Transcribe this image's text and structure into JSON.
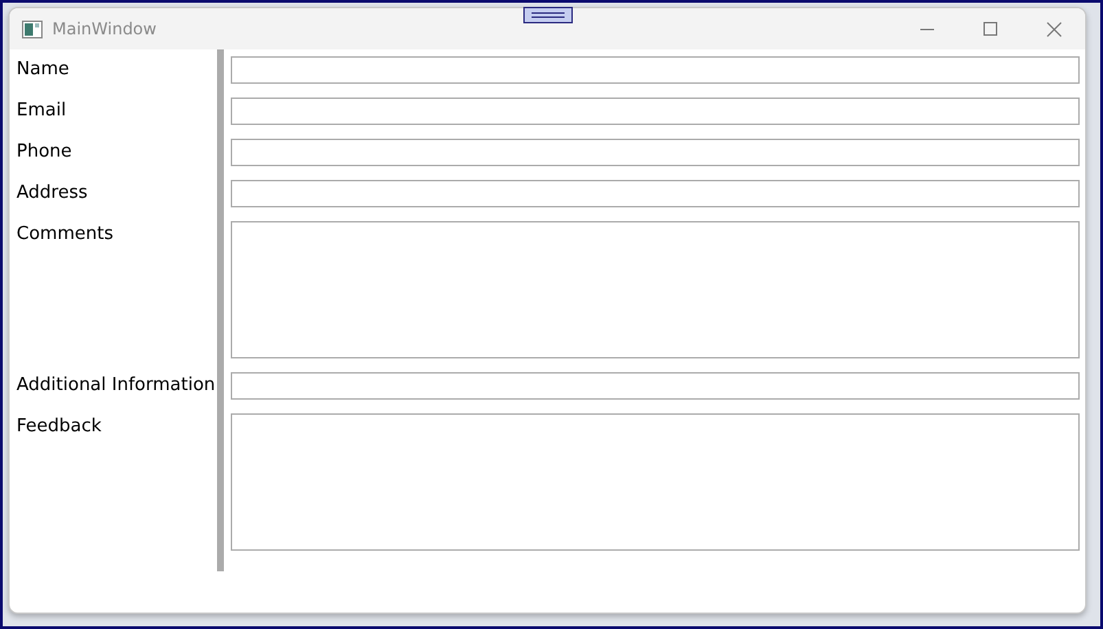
{
  "window": {
    "title": "MainWindow"
  },
  "fields": [
    {
      "label": "Name",
      "kind": "single"
    },
    {
      "label": "Email",
      "kind": "single"
    },
    {
      "label": "Phone",
      "kind": "single"
    },
    {
      "label": "Address",
      "kind": "single"
    },
    {
      "label": "Comments",
      "kind": "multi"
    },
    {
      "label": "Additional Information",
      "kind": "single"
    },
    {
      "label": "Feedback",
      "kind": "multi"
    }
  ]
}
